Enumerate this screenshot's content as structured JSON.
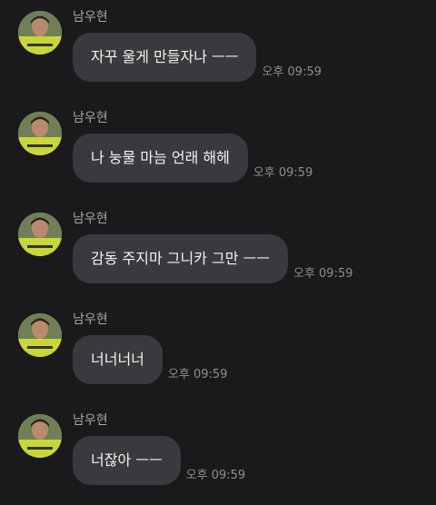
{
  "messages": [
    {
      "sender": "남우현",
      "text": "자꾸 울게 만들자나 ㅡㅡ",
      "time": "오후 09:59"
    },
    {
      "sender": "남우현",
      "text": "나 눙물 마늠 언래 해헤",
      "time": "오후 09:59"
    },
    {
      "sender": "남우현",
      "text": "감동 주지마 그니카 그만 ㅡㅡ",
      "time": "오후 09:59"
    },
    {
      "sender": "남우현",
      "text": "너너너너",
      "time": "오후 09:59"
    },
    {
      "sender": "남우현",
      "text": "너잖아 ㅡㅡ",
      "time": "오후 09:59"
    }
  ],
  "avatar": {
    "icon": "profile-photo-icon",
    "jersey_color": "#c9d63a"
  },
  "colors": {
    "background": "#1a1a1d",
    "bubble": "#3a3a3e",
    "bubble_text": "#f2f2f2",
    "sender_text": "#a7a7ab",
    "time_text": "#8e8e93"
  }
}
